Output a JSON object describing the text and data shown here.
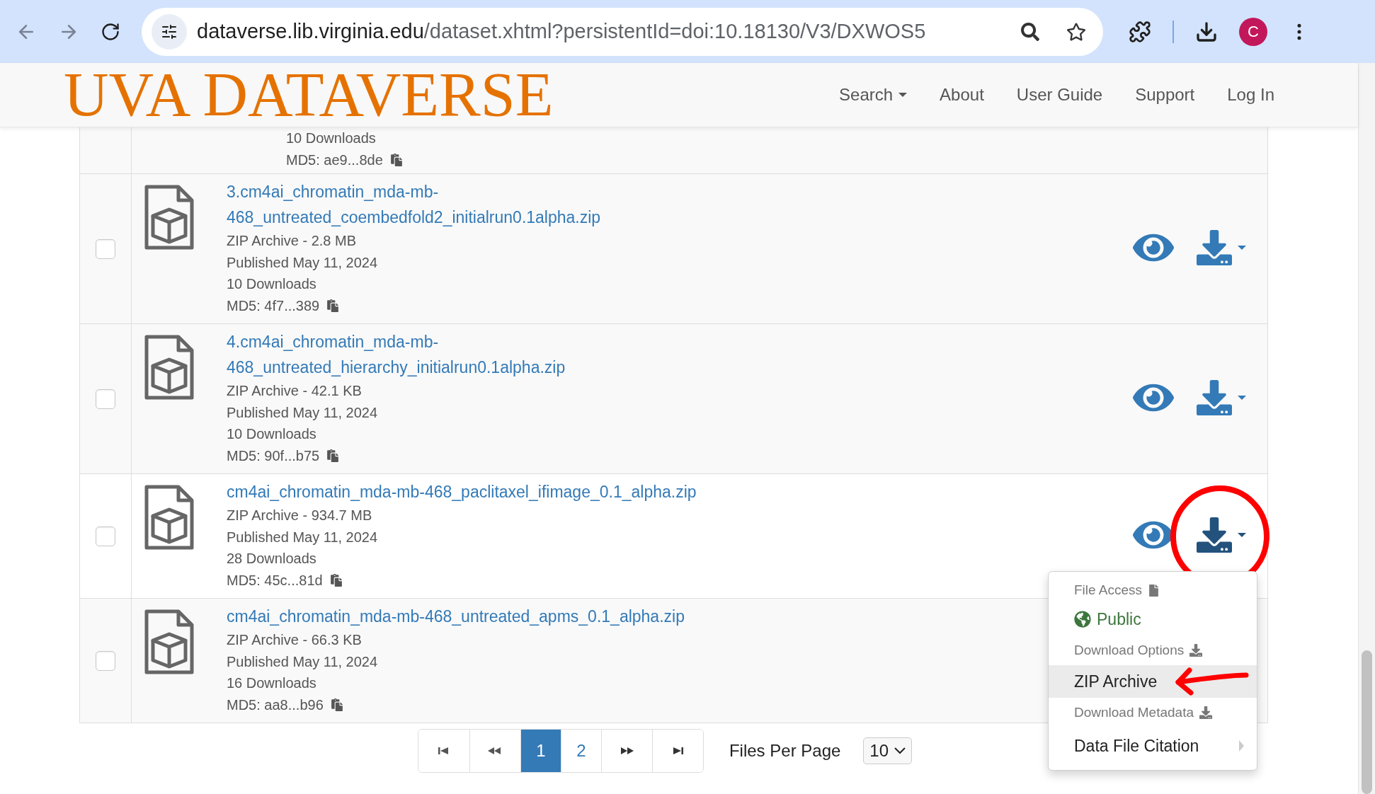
{
  "browser": {
    "url_host": "dataverse.lib.virginia.edu",
    "url_path": "/dataset.xhtml?persistentId=doi:10.18130/V3/DXWOS5",
    "profile_initial": "C"
  },
  "navbar": {
    "logo": "UVA DATAVERSE",
    "items": [
      {
        "label": "Search",
        "dropdown": true
      },
      {
        "label": "About",
        "dropdown": false
      },
      {
        "label": "User Guide",
        "dropdown": false
      },
      {
        "label": "Support",
        "dropdown": false
      },
      {
        "label": "Log In",
        "dropdown": false
      }
    ]
  },
  "partial_row": {
    "downloads": "10 Downloads",
    "md5": "MD5: ae9...8de"
  },
  "files": [
    {
      "name": "3.cm4ai_chromatin_mda-mb-468_untreated_coembedfold2_initialrun0.1alpha.zip",
      "type_size": "ZIP Archive - 2.8 MB",
      "published": "Published May 11, 2024",
      "downloads": "10 Downloads",
      "md5": "MD5: 4f7...389",
      "checked": false,
      "menu_open": false
    },
    {
      "name": "4.cm4ai_chromatin_mda-mb-468_untreated_hierarchy_initialrun0.1alpha.zip",
      "type_size": "ZIP Archive - 42.1 KB",
      "published": "Published May 11, 2024",
      "downloads": "10 Downloads",
      "md5": "MD5: 90f...b75",
      "checked": false,
      "menu_open": false
    },
    {
      "name": "cm4ai_chromatin_mda-mb-468_paclitaxel_ifimage_0.1_alpha.zip",
      "type_size": "ZIP Archive - 934.7 MB",
      "published": "Published May 11, 2024",
      "downloads": "28 Downloads",
      "md5": "MD5: 45c...81d",
      "checked": false,
      "menu_open": true
    },
    {
      "name": "cm4ai_chromatin_mda-mb-468_untreated_apms_0.1_alpha.zip",
      "type_size": "ZIP Archive - 66.3 KB",
      "published": "Published May 11, 2024",
      "downloads": "16 Downloads",
      "md5": "MD5: aa8...b96",
      "checked": false,
      "menu_open": false
    }
  ],
  "download_menu": [
    {
      "kind": "file-header",
      "label": "File Access"
    },
    {
      "kind": "status",
      "label": "Public"
    },
    {
      "kind": "download-header",
      "label": "Download Options"
    },
    {
      "kind": "option",
      "label": "ZIP Archive",
      "highlighted": true
    },
    {
      "kind": "download-header",
      "label": "Download Metadata"
    },
    {
      "kind": "submenu",
      "label": "Data File Citation"
    }
  ],
  "pagination": {
    "pages": [
      {
        "kind": "first"
      },
      {
        "kind": "prev"
      },
      {
        "kind": "page",
        "label": "1",
        "selected": true
      },
      {
        "kind": "page",
        "label": "2",
        "selected": false
      },
      {
        "kind": "next"
      },
      {
        "kind": "last"
      }
    ],
    "per_page_label": "Files Per Page",
    "per_page_value": "10"
  }
}
